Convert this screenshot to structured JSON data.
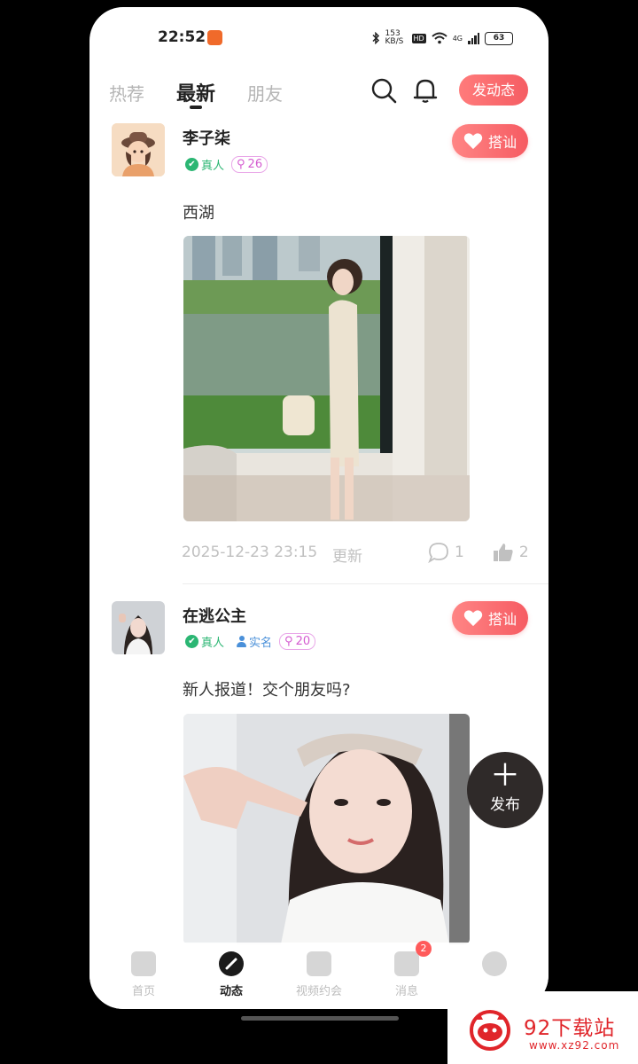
{
  "status_bar": {
    "time": "22:52",
    "network_speed": "153 KB/S",
    "hd": "HD",
    "net_type": "4G",
    "battery": "63"
  },
  "top_nav": {
    "tabs": [
      "热荐",
      "最新",
      "朋友"
    ],
    "active_tab": 1,
    "post_button": "发动态"
  },
  "posts": [
    {
      "username": "李子柒",
      "badges": {
        "real": "真人",
        "level": "26"
      },
      "text": "西湖",
      "timestamp": "2025-12-23 23:15",
      "status": "更新",
      "comments": "1",
      "likes": "2",
      "greet": "搭讪"
    },
    {
      "username": "在逃公主",
      "badges": {
        "real": "真人",
        "realname": "实名",
        "level": "20"
      },
      "text": "新人报道！交个朋友吗?",
      "greet": "搭讪"
    }
  ],
  "fab": {
    "label": "发布"
  },
  "bottom_nav": {
    "items": [
      {
        "label": "首页",
        "icon": "home-icon"
      },
      {
        "label": "动态",
        "icon": "pen-icon"
      },
      {
        "label": "视频约会",
        "icon": "video-icon"
      },
      {
        "label": "消息",
        "icon": "message-icon",
        "badge": "2"
      },
      {
        "label": "",
        "icon": "smiley-icon"
      }
    ],
    "active": 1
  },
  "watermark": {
    "title": "92下载站",
    "url": "www.xz92.com"
  },
  "colors": {
    "accent": "#f65b62",
    "real": "#2bb673",
    "realname": "#4a90d9",
    "level": "#d45bd0"
  }
}
